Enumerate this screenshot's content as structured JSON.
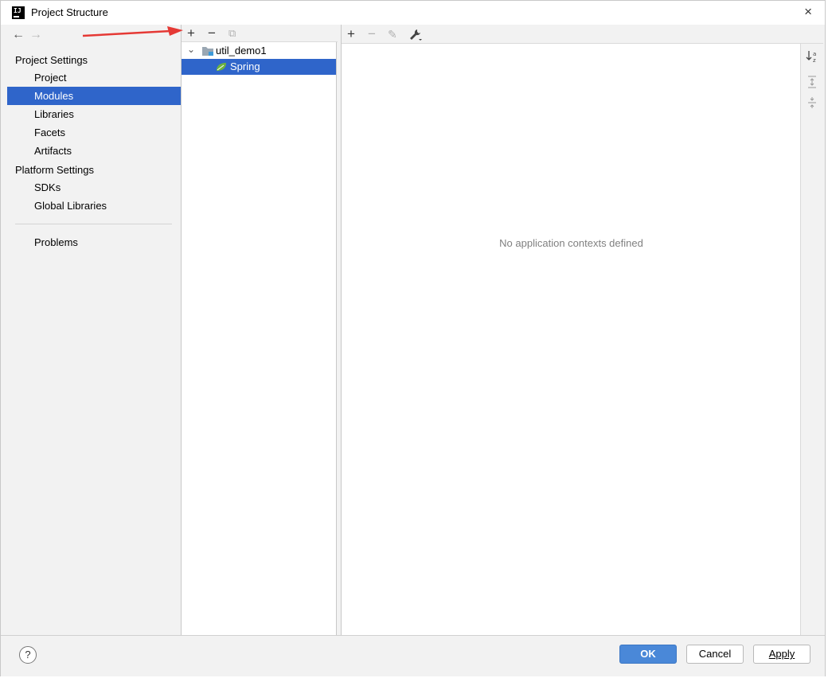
{
  "window": {
    "title": "Project Structure",
    "close_icon": "×"
  },
  "nav": {
    "back": "←",
    "forward": "→"
  },
  "sidebar": {
    "section1": "Project Settings",
    "items1": [
      "Project",
      "Modules",
      "Libraries",
      "Facets",
      "Artifacts"
    ],
    "section2": "Platform Settings",
    "items2": [
      "SDKs",
      "Global Libraries"
    ],
    "problems": "Problems",
    "selected": "Modules"
  },
  "modules_toolbar": {
    "add": "+",
    "remove": "−",
    "copy": "⧉"
  },
  "tree": {
    "expander": "⌄",
    "module": "util_demo1",
    "facet": "Spring",
    "selected": "Spring"
  },
  "contexts_toolbar": {
    "add": "+",
    "remove": "−",
    "edit": "✎",
    "settings": "🔧"
  },
  "contexts": {
    "empty_message": "No application contexts defined"
  },
  "right_strip": {
    "sort": "↓a z",
    "expand": "⇕",
    "collapse": "⇳"
  },
  "footer": {
    "help": "?",
    "ok": "OK",
    "cancel": "Cancel",
    "apply": "Apply"
  },
  "colors": {
    "selection": "#2f65ca",
    "primary_button": "#4a88d8",
    "annotation_arrow": "#e53935",
    "spring_leaf": "#6db33f"
  },
  "icons": [
    "app-icon",
    "back-arrow-icon",
    "forward-arrow-icon",
    "add-icon",
    "remove-icon",
    "copy-icon",
    "folder-icon",
    "spring-leaf-icon",
    "edit-icon",
    "wrench-icon",
    "sort-alpha-icon",
    "expand-all-icon",
    "collapse-all-icon",
    "help-icon",
    "close-icon"
  ]
}
